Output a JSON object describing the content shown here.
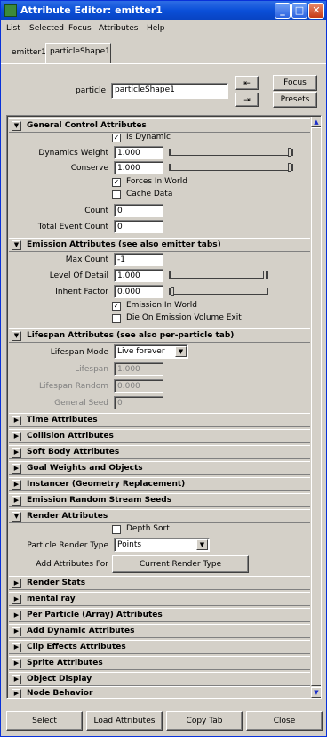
{
  "window": {
    "title": "Attribute Editor: emitter1",
    "min": "_",
    "max": "□",
    "close": "✕"
  },
  "menu": [
    "List",
    "Selected",
    "Focus",
    "Attributes",
    "Help"
  ],
  "tabs": [
    "emitter1",
    "particleShape1"
  ],
  "header": {
    "particle_label": "particle",
    "particle_value": "particleShape1",
    "focus": "Focus",
    "presets": "Presets"
  },
  "sections": {
    "general": {
      "title": "General Control Attributes",
      "is_dynamic": "Is Dynamic",
      "dyn_weight_label": "Dynamics Weight",
      "dyn_weight": "1.000",
      "conserve_label": "Conserve",
      "conserve": "1.000",
      "forces_world": "Forces In World",
      "cache_data": "Cache Data",
      "count_label": "Count",
      "count": "0",
      "total_event_label": "Total Event Count",
      "total_event": "0"
    },
    "emission": {
      "title": "Emission Attributes (see also emitter tabs)",
      "max_count_label": "Max Count",
      "max_count": "-1",
      "lod_label": "Level Of Detail",
      "lod": "1.000",
      "inherit_label": "Inherit Factor",
      "inherit": "0.000",
      "emission_world": "Emission In World",
      "die_on_exit": "Die On Emission Volume Exit"
    },
    "lifespan": {
      "title": "Lifespan Attributes (see also per-particle tab)",
      "mode_label": "Lifespan Mode",
      "mode": "Live forever",
      "lifespan_label": "Lifespan",
      "lifespan": "1.000",
      "random_label": "Lifespan Random",
      "random": "0.000",
      "seed_label": "General Seed",
      "seed": "0"
    },
    "collapsed1": [
      "Time Attributes",
      "Collision Attributes",
      "Soft Body Attributes",
      "Goal Weights and Objects",
      "Instancer (Geometry Replacement)",
      "Emission Random Stream Seeds"
    ],
    "render": {
      "title": "Render Attributes",
      "depth_sort": "Depth Sort",
      "type_label": "Particle Render Type",
      "type": "Points",
      "add_label": "Add Attributes For",
      "add_btn": "Current Render Type"
    },
    "collapsed2": [
      "Render Stats",
      "mental ray",
      "Per Particle (Array) Attributes",
      "Add Dynamic Attributes",
      "Clip Effects Attributes",
      "Sprite Attributes",
      "Object Display",
      "Node Behavior"
    ]
  },
  "bottom": [
    "Select",
    "Load Attributes",
    "Copy Tab",
    "Close"
  ]
}
